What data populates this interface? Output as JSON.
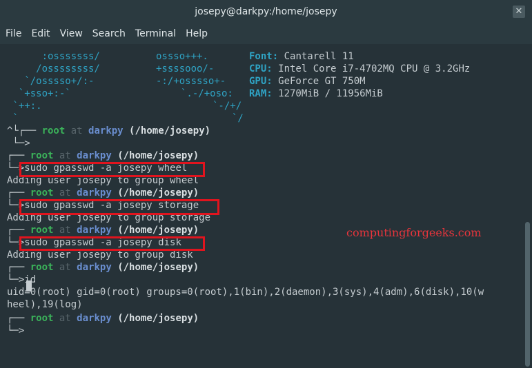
{
  "window": {
    "title": "josepy@darkpy:/home/josepy",
    "close": "✕"
  },
  "menu": [
    "File",
    "Edit",
    "View",
    "Search",
    "Terminal",
    "Help"
  ],
  "logo": {
    "a": [
      "      :osssssss/",
      "     /ossssssss/",
      "   `/osssso+/:-",
      "  `+sso+:-`",
      " `++:.",
      " `"
    ],
    "b": [
      "ossso+++.",
      "+ssssooo/-",
      "-:/+osssso+-",
      "`.-/+oso:",
      "`-/+/",
      "`/"
    ]
  },
  "sysinfo": [
    {
      "label": "Font:",
      "value": " Cantarell 11"
    },
    {
      "label": "CPU:",
      "value": " Intel Core i7-4702MQ CPU @ 3.2GHz"
    },
    {
      "label": "GPU:",
      "value": " GeForce GT 750M"
    },
    {
      "label": "RAM:",
      "value": " 1270MiB / 11956MiB"
    }
  ],
  "prompt": {
    "user": "root",
    "at": "at",
    "host": "darkpy",
    "path": "(/home/josepy)"
  },
  "commands": [
    {
      "cmd": "sudo gpasswd -a josepy wheel",
      "out": "Adding user josepy to group wheel"
    },
    {
      "cmd": "sudo gpasswd -a josepy storage",
      "out": "Adding user josepy to group storage"
    },
    {
      "cmd": "sudo gpasswd -a josepy disk",
      "out": "Adding user josepy to group disk"
    },
    {
      "cmd": "id",
      "out": "uid=0(root) gid=0(root) groups=0(root),1(bin),2(daemon),3(sys),4(adm),6(disk),10(w",
      "out2": "heel),19(log)"
    }
  ],
  "watermark": "computingforgeeks.com"
}
